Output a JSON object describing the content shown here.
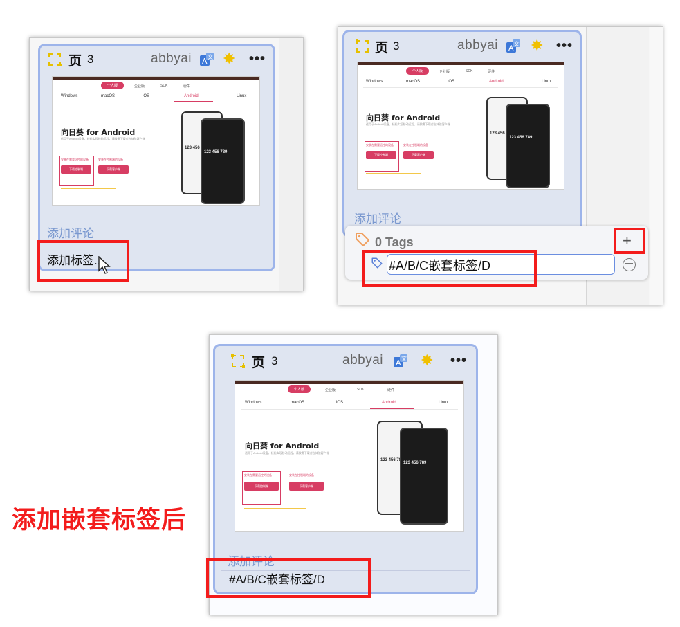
{
  "card": {
    "page_label": "页",
    "page_number": "3",
    "brand": "abbyai",
    "translate_icon": "translate-icon",
    "star_icon": "star-icon",
    "more_label": "•••",
    "comment_placeholder": "添加评论"
  },
  "thumbnail": {
    "tabs": [
      "个人版",
      "企业版",
      "SDK",
      "硬件"
    ],
    "os_tabs": [
      "Windows",
      "macOS",
      "iOS",
      "Android",
      "Linux"
    ],
    "heading": "向日葵 for Android",
    "description": "适用于Android设备，轻松实现移动远程，请按需下载对应体验客户端",
    "link_left": "安装在需要远控的设备",
    "link_right": "安装在控制端的设备",
    "button_left": "下载控制端",
    "button_right": "下载客户端",
    "phone_number": "123 456 789"
  },
  "panel1": {
    "tag_prompt": "添加标签..."
  },
  "panel2": {
    "tags_title": "0 Tags",
    "tag_input_value": "#A/B/C嵌套标签/D",
    "plus_label": "+"
  },
  "panel3": {
    "tag_value": "#A/B/C嵌套标签/D"
  },
  "annotation": {
    "after_label": "添加嵌套标签后",
    "highlight_color": "#f31c1c"
  },
  "colors": {
    "card_border": "#9db4ea",
    "accent": "#d73d63",
    "frame_icon": "#e6c000"
  }
}
